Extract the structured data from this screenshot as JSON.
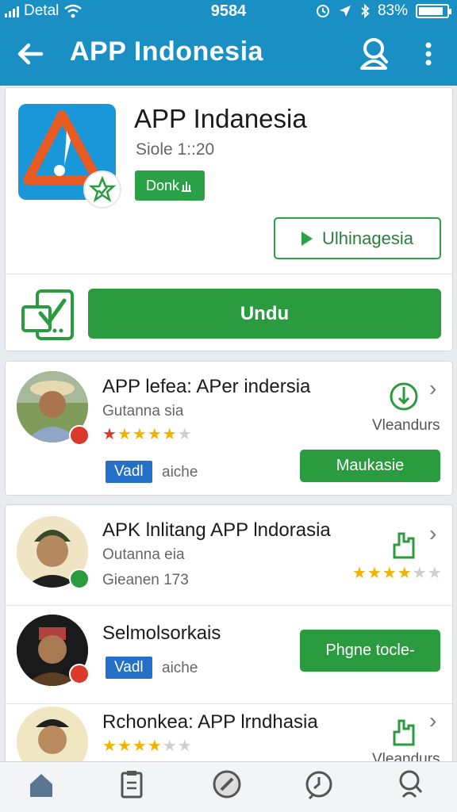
{
  "status_bar": {
    "carrier": "Detal",
    "time": "9584",
    "battery": "83%"
  },
  "appbar": {
    "title": "APP Indonesia"
  },
  "app": {
    "title": "APP Indanesia",
    "size": "Siole 1::20",
    "chip": "Donk",
    "secondary_button": "Ulhinagesia",
    "download_button": "Undu"
  },
  "list": [
    {
      "title": "APP lefea: APer indersia",
      "subtitle": "Gutanna sia",
      "rating": 4,
      "chip": "Vadl",
      "chip_text": "aiche",
      "side_label": "Vleandurs",
      "button": "Maukasie"
    },
    {
      "title": "APK lnlitang APP lndorasia",
      "subtitle": "Outanna eia",
      "meta": "Gieanen 173",
      "rating": 3.5
    },
    {
      "title": "Selmolsorkais",
      "chip": "Vadl",
      "chip_text": "aiche",
      "button": "Phgne tocle-"
    },
    {
      "title": "Rchonkea: APP lrndhasia",
      "rating": 3.5,
      "side_label": "Vleandurs"
    }
  ],
  "colors": {
    "primary": "#1a8fc4",
    "accent_green": "#2a9b3f",
    "chip_blue": "#2470c9",
    "star": "#f0b400"
  },
  "bottom_nav": [
    {
      "icon": "home-icon"
    },
    {
      "icon": "clipboard-icon"
    },
    {
      "icon": "compass-icon"
    },
    {
      "icon": "timer-icon"
    },
    {
      "icon": "search-icon"
    }
  ]
}
